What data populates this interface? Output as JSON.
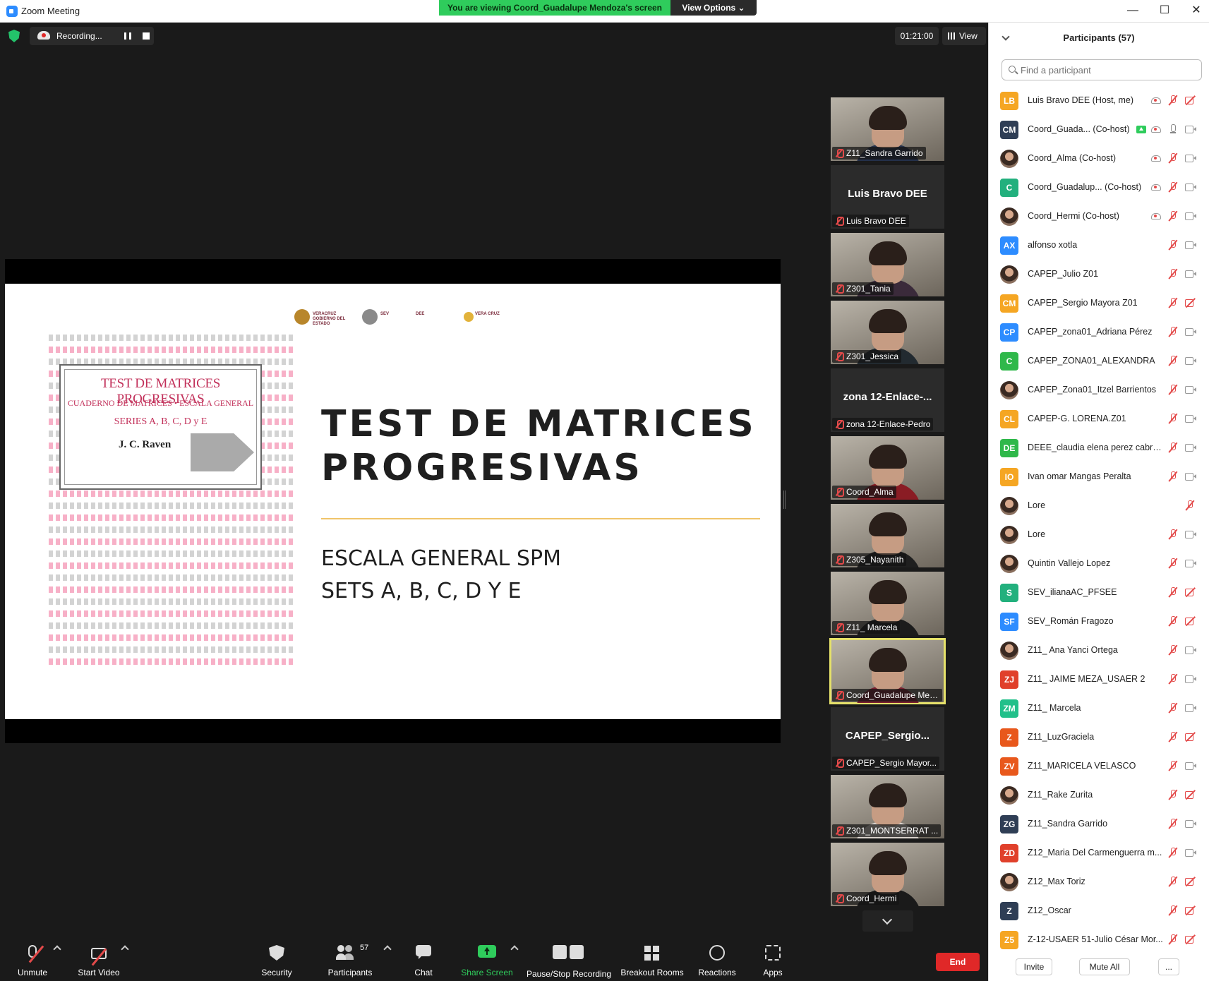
{
  "window": {
    "title": "Zoom Meeting"
  },
  "banner": {
    "viewing": "You are viewing Coord_Guadalupe Mendoza's screen",
    "view_options": "View Options ⌄"
  },
  "window_controls": {
    "minimize": "—",
    "maximize": "☐",
    "close": "✕"
  },
  "recording": {
    "label": "Recording..."
  },
  "timer": "01:21:00",
  "view_label": "View",
  "slide": {
    "cover_title": "TEST DE MATRICES PROGRESIVAS",
    "cover_subtitle": "CUADERNO DE MATRICES • ESCALA GENERAL",
    "cover_series": "SERIES A, B, C, D y E",
    "cover_author": "J. C. Raven",
    "title_line1": "TEST DE MATRICES",
    "title_line2": "PROGRESIVAS",
    "subtitle1": "ESCALA GENERAL SPM",
    "subtitle2": "SETS A, B, C, D Y E",
    "logos": [
      "VERACRUZ GOBIERNO DEL ESTADO",
      "SEV",
      "DEE",
      "VERA CRUZ"
    ]
  },
  "video_tiles": [
    {
      "name": "Z11_Sandra Garrido",
      "kind": "photo",
      "body_color": "#24304a"
    },
    {
      "name": "Luis Bravo DEE",
      "kind": "name",
      "big": "Luis Bravo DEE"
    },
    {
      "name": "Z301_Tania",
      "kind": "photo",
      "body_color": "#3a2a3a"
    },
    {
      "name": "Z301_Jessica",
      "kind": "photo",
      "body_color": "#222a30"
    },
    {
      "name": "zona 12-Enlace-Pedro",
      "kind": "name",
      "big": "zona  12-Enlace-..."
    },
    {
      "name": "Coord_Alma",
      "kind": "photo",
      "body_color": "#8a1c24"
    },
    {
      "name": "Z305_Nayanith",
      "kind": "photo",
      "body_color": "#1f1f1f"
    },
    {
      "name": "Z11_ Marcela",
      "kind": "photo",
      "body_color": "#1c1c1c"
    },
    {
      "name": "Coord_Guadalupe Mend...",
      "kind": "photo",
      "body_color": "#7a2030",
      "active": true
    },
    {
      "name": "CAPEP_Sergio Mayor...",
      "kind": "name",
      "big": "CAPEP_Sergio..."
    },
    {
      "name": "Z301_MONTSERRAT ...",
      "kind": "photo",
      "body_color": "#d9d2cc"
    },
    {
      "name": "Coord_Hermi",
      "kind": "photo",
      "body_color": "#1a1a1a"
    }
  ],
  "toolbar": {
    "unmute": "Unmute",
    "start_video": "Start Video",
    "security": "Security",
    "participants": "Participants",
    "participants_count": "57",
    "chat": "Chat",
    "share_screen": "Share Screen",
    "pause_stop": "Pause/Stop Recording",
    "breakout": "Breakout Rooms",
    "reactions": "Reactions",
    "apps": "Apps",
    "end": "End"
  },
  "panel": {
    "title": "Participants (57)",
    "search_placeholder": "Find a participant",
    "invite": "Invite",
    "mute_all": "Mute All",
    "more": "..."
  },
  "participants": [
    {
      "initials": "LB",
      "color": "#f5a623",
      "name": "Luis Bravo DEE (Host, me)",
      "rec": true,
      "mic": "muted",
      "cam": "off"
    },
    {
      "initials": "CM",
      "color": "#2f3e55",
      "name": "Coord_Guada... (Co-host)",
      "share": true,
      "rec": true,
      "mic": "on",
      "cam": "on"
    },
    {
      "initials": "",
      "color": "",
      "photo": true,
      "name": "Coord_Alma (Co-host)",
      "rec": true,
      "mic": "muted",
      "cam": "on"
    },
    {
      "initials": "C",
      "color": "#22b07d",
      "name": "Coord_Guadalup...  (Co-host)",
      "rec": true,
      "mic": "muted",
      "cam": "on"
    },
    {
      "initials": "",
      "color": "",
      "photo": true,
      "name": "Coord_Hermi (Co-host)",
      "rec": true,
      "mic": "muted",
      "cam": "on"
    },
    {
      "initials": "AX",
      "color": "#2d8cff",
      "name": "alfonso xotla",
      "mic": "muted",
      "cam": "on"
    },
    {
      "initials": "",
      "color": "",
      "photo": true,
      "name": "CAPEP_Julio Z01",
      "mic": "muted",
      "cam": "on"
    },
    {
      "initials": "CM",
      "color": "#f5a623",
      "name": "CAPEP_Sergio Mayora Z01",
      "mic": "muted",
      "cam": "off"
    },
    {
      "initials": "CP",
      "color": "#2d8cff",
      "name": "CAPEP_zona01_Adriana Pérez",
      "mic": "muted",
      "cam": "on"
    },
    {
      "initials": "C",
      "color": "#2fb84a",
      "name": "CAPEP_ZONA01_ALEXANDRA",
      "mic": "muted",
      "cam": "on"
    },
    {
      "initials": "",
      "color": "",
      "photo": true,
      "name": "CAPEP_Zona01_Itzel Barrientos",
      "mic": "muted",
      "cam": "on"
    },
    {
      "initials": "CL",
      "color": "#f5a623",
      "name": "CAPEP-G. LORENA.Z01",
      "mic": "muted",
      "cam": "on"
    },
    {
      "initials": "DE",
      "color": "#2fb84a",
      "name": "DEEE_claudia elena perez cabre...",
      "mic": "muted",
      "cam": "on"
    },
    {
      "initials": "IO",
      "color": "#f5a623",
      "name": "Ivan omar Mangas Peralta",
      "mic": "muted",
      "cam": "on"
    },
    {
      "initials": "",
      "color": "",
      "photo": true,
      "name": "Lore",
      "mic": "muted-right",
      "cam": "none"
    },
    {
      "initials": "",
      "color": "",
      "photo": true,
      "name": "Lore",
      "mic": "muted",
      "cam": "on"
    },
    {
      "initials": "",
      "color": "",
      "photo": true,
      "name": "Quintin Vallejo Lopez",
      "mic": "muted",
      "cam": "on"
    },
    {
      "initials": "S",
      "color": "#22b07d",
      "name": "SEV_ilianaAC_PFSEE",
      "mic": "muted",
      "cam": "off"
    },
    {
      "initials": "SF",
      "color": "#2d8cff",
      "name": "SEV_Román Fragozo",
      "mic": "muted",
      "cam": "off"
    },
    {
      "initials": "",
      "color": "",
      "photo": true,
      "name": "Z11_ Ana Yanci Ortega",
      "mic": "muted",
      "cam": "on"
    },
    {
      "initials": "ZJ",
      "color": "#e0402b",
      "name": "Z11_ JAIME MEZA_USAER 2",
      "mic": "muted",
      "cam": "on"
    },
    {
      "initials": "ZM",
      "color": "#22c08a",
      "name": "Z11_ Marcela",
      "mic": "muted",
      "cam": "on"
    },
    {
      "initials": "Z",
      "color": "#e8581c",
      "name": "Z11_LuzGraciela",
      "mic": "muted",
      "cam": "off"
    },
    {
      "initials": "ZV",
      "color": "#e8581c",
      "name": "Z11_MARICELA VELASCO",
      "mic": "muted",
      "cam": "on"
    },
    {
      "initials": "",
      "color": "",
      "photo": true,
      "name": "Z11_Rake Zurita",
      "mic": "muted",
      "cam": "off"
    },
    {
      "initials": "ZG",
      "color": "#2f3e55",
      "name": "Z11_Sandra Garrido",
      "mic": "muted",
      "cam": "on"
    },
    {
      "initials": "ZD",
      "color": "#e0402b",
      "name": "Z12_Maria Del Carmenguerra m...",
      "mic": "muted",
      "cam": "on"
    },
    {
      "initials": "",
      "color": "",
      "photo": true,
      "name": "Z12_Max Toriz",
      "mic": "muted",
      "cam": "off"
    },
    {
      "initials": "Z",
      "color": "#2f3e55",
      "name": "Z12_Oscar",
      "mic": "muted",
      "cam": "off"
    },
    {
      "initials": "Z5",
      "color": "#f5a623",
      "name": "Z-12-USAER 51-Julio César Mor...",
      "mic": "muted",
      "cam": "off"
    }
  ]
}
